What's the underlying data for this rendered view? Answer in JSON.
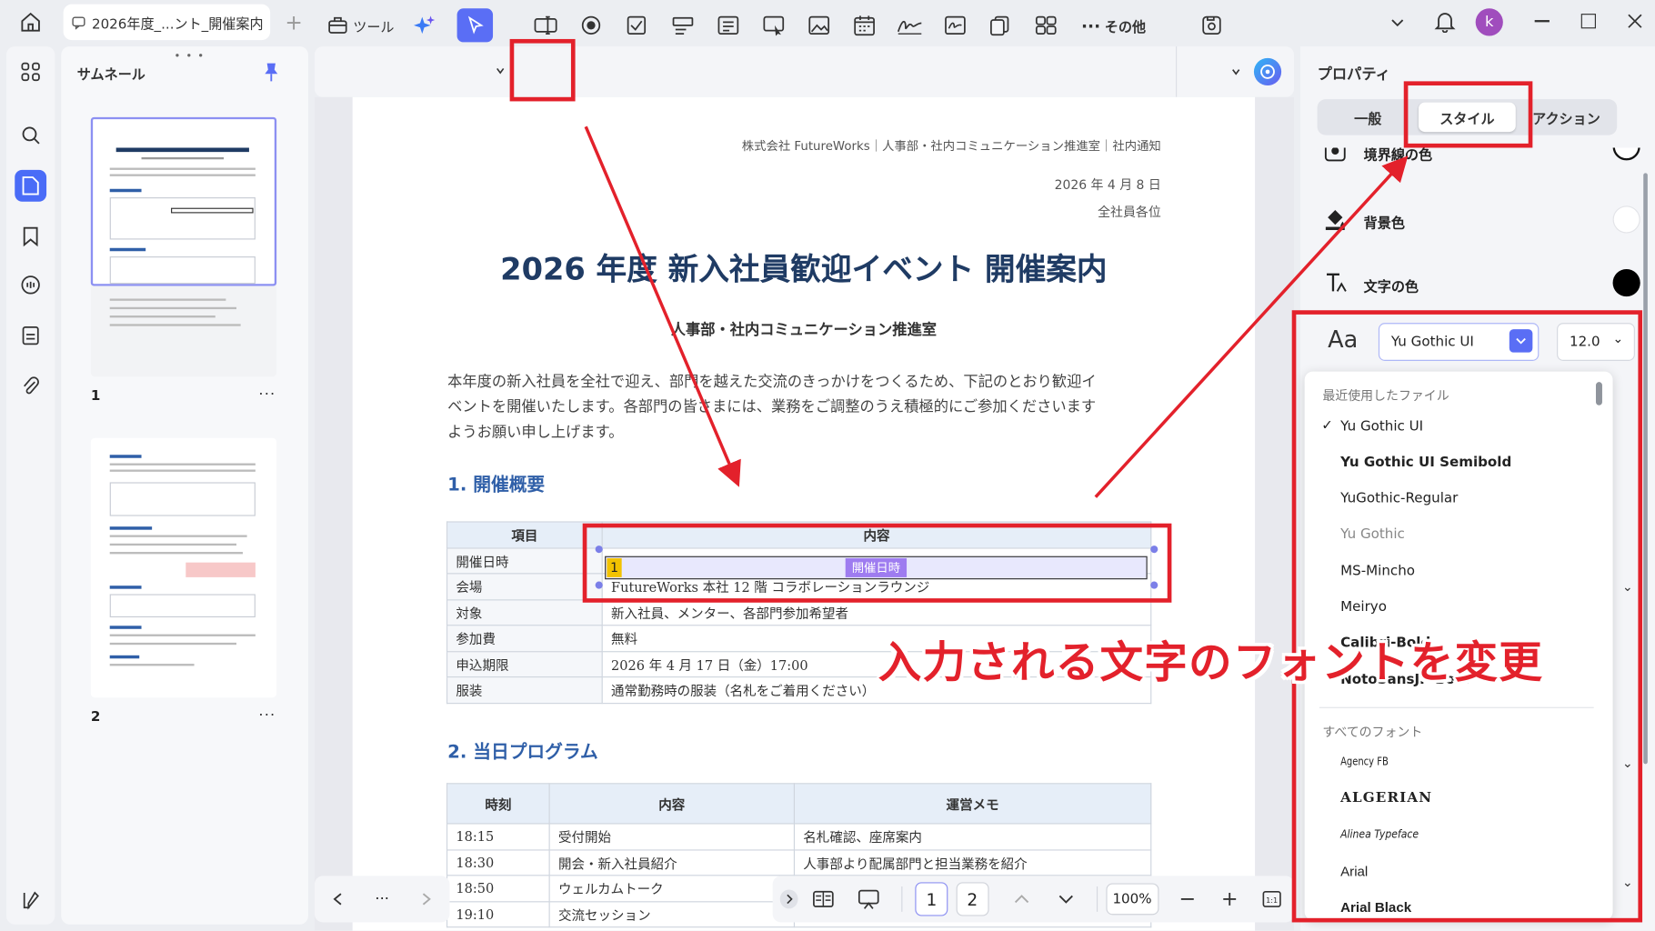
{
  "tab": {
    "title": "2026年度_...ント_開催案内"
  },
  "user": {
    "avatar_letter": "k"
  },
  "thumbnails": {
    "title": "サムネール",
    "pages": [
      {
        "num": "1"
      },
      {
        "num": "2"
      }
    ]
  },
  "toolbar": {
    "tools_label": "ツール",
    "more_label": "その他"
  },
  "document": {
    "org_line": "株式会社 FutureWorks｜人事部・社内コミュニケーション推進室｜社内通知",
    "date": "2026 年 4 月 8 日",
    "to": "全社員各位",
    "title": "2026 年度 新入社員歓迎イベント 開催案内",
    "subtitle": "人事部・社内コミュニケーション推進室",
    "intro_1": "本年度の新入社員を全社で迎え、部門を越えた交流のきっかけをつくるため、下記のとおり歓迎イ",
    "intro_2": "ベントを開催いたします。各部門の皆さまには、業務をご調整のうえ積極的にご参加くださいます",
    "intro_3": "ようお願い申し上げます。",
    "section1": "1. 開催概要",
    "table1": {
      "headers": [
        "項目",
        "内容"
      ],
      "rows": [
        [
          "開催日時",
          ""
        ],
        [
          "会場",
          "FutureWorks 本社 12 階 コラボレーションラウンジ"
        ],
        [
          "対象",
          "新入社員、メンター、各部門参加希望者"
        ],
        [
          "参加費",
          "無料"
        ],
        [
          "申込期限",
          "2026 年 4 月 17 日（金）17:00"
        ],
        [
          "服装",
          "通常勤務時の服装（名札をご着用ください）"
        ]
      ]
    },
    "field": {
      "number": "1",
      "name": "開催日時"
    },
    "section2": "2. 当日プログラム",
    "table2": {
      "headers": [
        "時刻",
        "内容",
        "運営メモ"
      ],
      "rows": [
        [
          "18:15",
          "受付開始",
          "名札確認、座席案内"
        ],
        [
          "18:30",
          "開会・新入社員紹介",
          "人事部より配属部門と担当業務を紹介"
        ],
        [
          "18:50",
          "ウェルカムトーク",
          ""
        ],
        [
          "19:10",
          "交流セッション",
          ""
        ]
      ]
    }
  },
  "nav": {
    "page1": "1",
    "page2": "2",
    "zoom": "100%"
  },
  "properties": {
    "title": "プロパティ",
    "tabs": [
      "一般",
      "スタイル",
      "アクション"
    ],
    "active_tab": "スタイル",
    "border_color_label": "境界線の色",
    "bg_color_label": "背景色",
    "text_color_label": "文字の色",
    "font_icon": "Aa",
    "font_value": "Yu Gothic UI",
    "size_value": "12.0",
    "colors": {
      "accent": "#5a6ef5",
      "text_color": "#000000",
      "bg_color": "#ffffff"
    }
  },
  "font_dropdown": {
    "recent_header": "最近使用したファイル",
    "recent": [
      "Yu Gothic UI",
      "Yu Gothic UI Semibold",
      "YuGothic-Regular",
      "Yu Gothic",
      "MS-Mincho",
      "Meiryo",
      "Calibri-Bold",
      "NotoSansJP-Bold"
    ],
    "selected": "Yu Gothic UI",
    "all_header": "すべてのフォント",
    "all": [
      "Agency FB",
      "ALGERIAN",
      "Alinea Typeface",
      "Arial",
      "Arial Black"
    ]
  },
  "annotation": {
    "caption": "入力される文字のフォントを変更",
    "color": "#e3212b"
  }
}
